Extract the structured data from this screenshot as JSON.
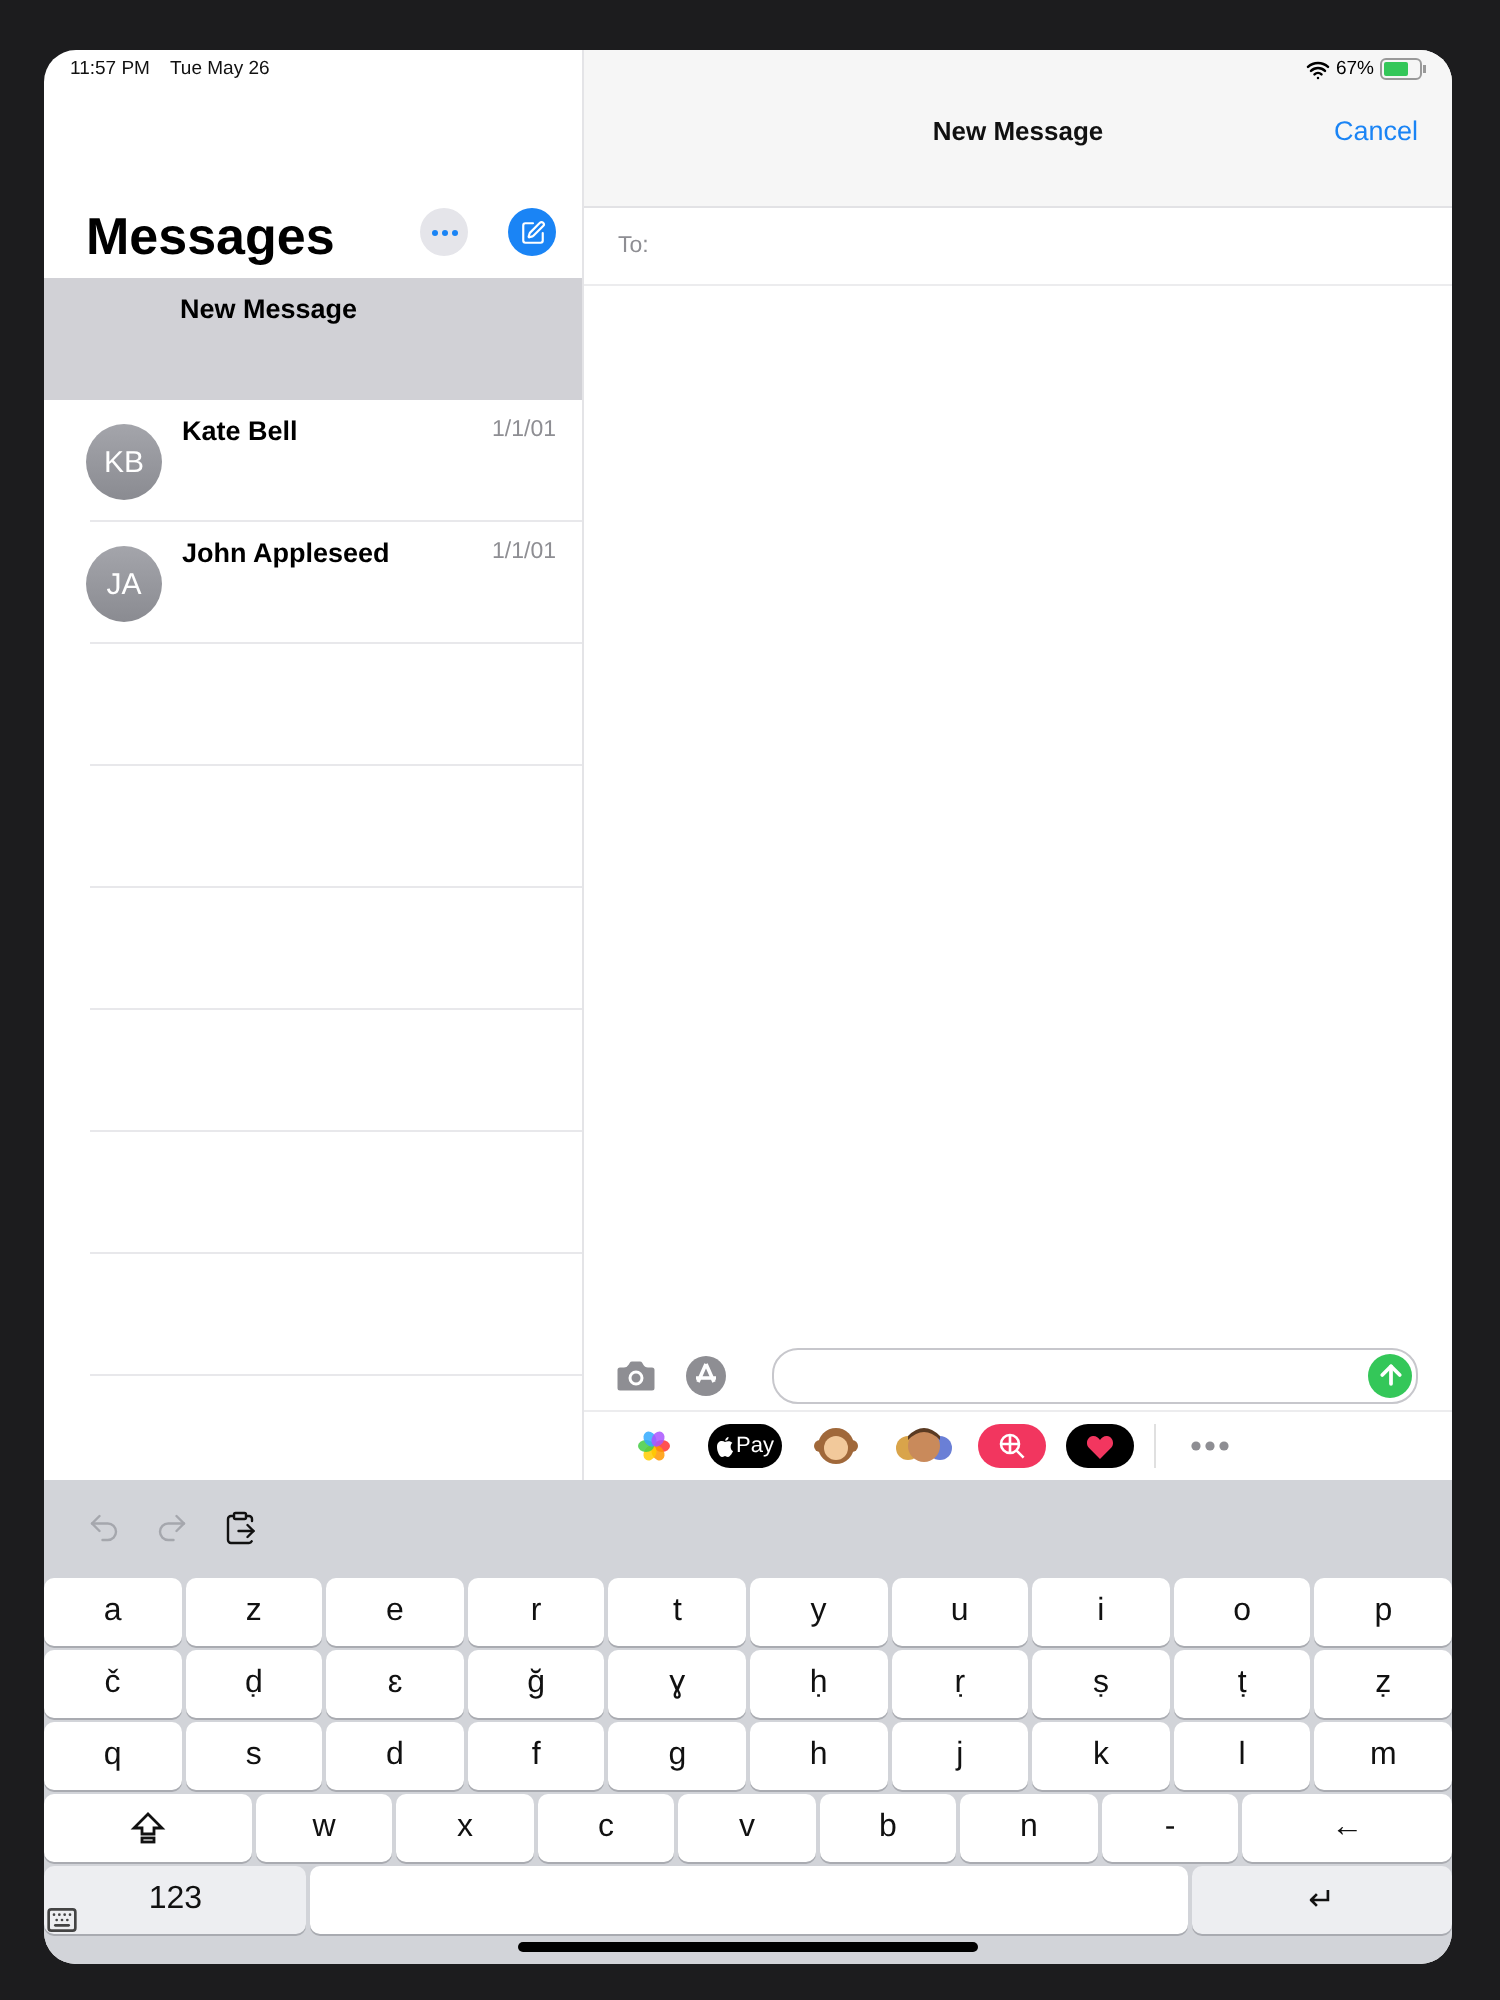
{
  "status_bar": {
    "time": "11:57 PM",
    "date": "Tue May 26",
    "battery": "67%"
  },
  "sidebar": {
    "title": "Messages",
    "items": [
      {
        "name": "New Message",
        "selected": true
      },
      {
        "name": "Kate Bell",
        "initials": "KB",
        "date": "1/1/01",
        "selected": false
      },
      {
        "name": "John Appleseed",
        "initials": "JA",
        "date": "1/1/01",
        "selected": false
      }
    ]
  },
  "compose": {
    "title": "New Message",
    "cancel": "Cancel",
    "to_label": "To:"
  },
  "app_strip": [
    {
      "kind": "photos"
    },
    {
      "kind": "pay",
      "label": "Pay"
    },
    {
      "kind": "monkey"
    },
    {
      "kind": "memoji"
    },
    {
      "kind": "search"
    },
    {
      "kind": "heart"
    },
    {
      "kind": "more"
    }
  ],
  "keyboard": {
    "toolbar": [
      {
        "kind": "undo",
        "disabled": true
      },
      {
        "kind": "redo",
        "disabled": true
      },
      {
        "kind": "paste",
        "disabled": false
      }
    ],
    "rows": [
      [
        {
          "kind": "letter",
          "label": "a"
        },
        {
          "kind": "letter",
          "label": "z"
        },
        {
          "kind": "letter",
          "label": "e"
        },
        {
          "kind": "letter",
          "label": "r"
        },
        {
          "kind": "letter",
          "label": "t"
        },
        {
          "kind": "letter",
          "label": "y"
        },
        {
          "kind": "letter",
          "label": "u"
        },
        {
          "kind": "letter",
          "label": "i"
        },
        {
          "kind": "letter",
          "label": "o"
        },
        {
          "kind": "letter",
          "label": "p"
        }
      ],
      [
        {
          "kind": "letter",
          "label": "č"
        },
        {
          "kind": "letter",
          "label": "ḍ"
        },
        {
          "kind": "letter",
          "label": "ɛ"
        },
        {
          "kind": "letter",
          "label": "ğ"
        },
        {
          "kind": "letter",
          "label": "ɣ"
        },
        {
          "kind": "letter",
          "label": "ḥ"
        },
        {
          "kind": "letter",
          "label": "ṛ"
        },
        {
          "kind": "letter",
          "label": "ṣ"
        },
        {
          "kind": "letter",
          "label": "ṭ"
        },
        {
          "kind": "letter",
          "label": "ẓ"
        }
      ],
      [
        {
          "kind": "letter",
          "label": "q"
        },
        {
          "kind": "letter",
          "label": "s"
        },
        {
          "kind": "letter",
          "label": "d"
        },
        {
          "kind": "letter",
          "label": "f"
        },
        {
          "kind": "letter",
          "label": "g"
        },
        {
          "kind": "letter",
          "label": "h"
        },
        {
          "kind": "letter",
          "label": "j"
        },
        {
          "kind": "letter",
          "label": "k"
        },
        {
          "kind": "letter",
          "label": "l"
        },
        {
          "kind": "letter",
          "label": "m"
        }
      ],
      [
        {
          "kind": "shift"
        },
        {
          "kind": "letter",
          "label": "w"
        },
        {
          "kind": "letter",
          "label": "x"
        },
        {
          "kind": "letter",
          "label": "c"
        },
        {
          "kind": "letter",
          "label": "v"
        },
        {
          "kind": "letter",
          "label": "b"
        },
        {
          "kind": "letter",
          "label": "n"
        },
        {
          "kind": "letter",
          "label": "-"
        },
        {
          "kind": "backspace",
          "label": "←"
        }
      ],
      [
        {
          "kind": "numbers",
          "label": "123"
        },
        {
          "kind": "space"
        },
        {
          "kind": "return",
          "label": "↵"
        }
      ]
    ]
  }
}
